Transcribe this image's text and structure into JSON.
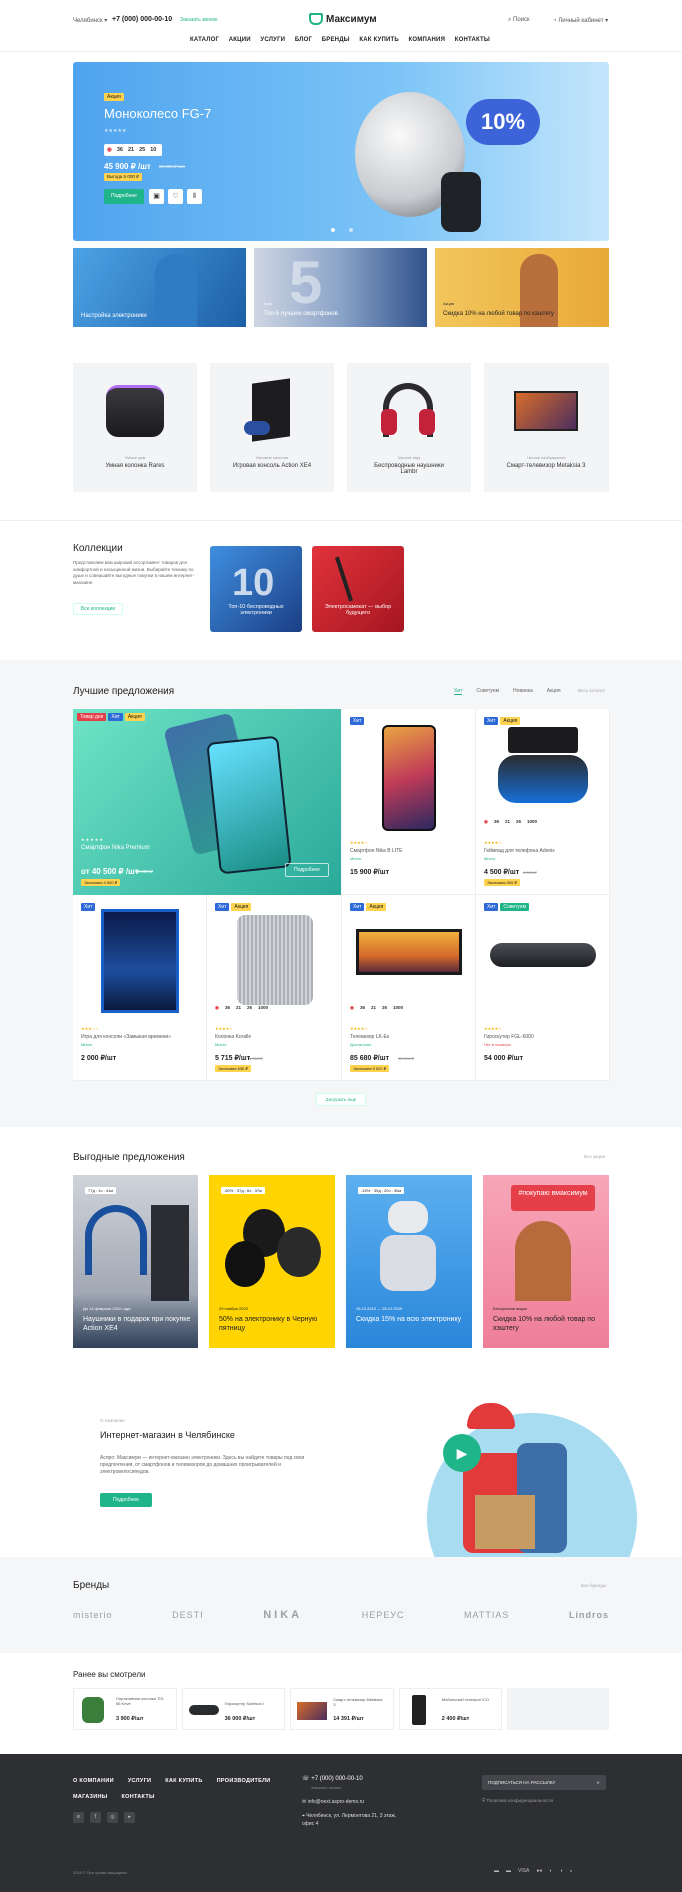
{
  "header": {
    "city": "Челябинск",
    "phone": "+7 (000) 000-00-10",
    "callback": "Заказать звонок",
    "logo": "Максимум",
    "search": "Поиск",
    "account": "Личный кабинет"
  },
  "nav": [
    "КАТАЛОГ",
    "АКЦИИ",
    "УСЛУГИ",
    "БЛОГ",
    "БРЕНДЫ",
    "КАК КУПИТЬ",
    "КОМПАНИЯ",
    "КОНТАКТЫ"
  ],
  "hero": {
    "badge": "Акция",
    "title": "Моноколесо FG-7",
    "timer": [
      "36",
      "21",
      "25",
      "10"
    ],
    "price": "45 900 ₽ /шт",
    "old_price": "50 900 ₽ /шт",
    "stock": "Выгода 5 000 ₽",
    "more": "Подробнее",
    "discount": "10%"
  },
  "banners": [
    {
      "cap": "Настройка электроники"
    },
    {
      "cap": "Топ-5 лучших смартфонов",
      "small": "Блог"
    },
    {
      "cap": "Скидка 10% на любой товар по кэштегу",
      "small": "Акция"
    }
  ],
  "products_top": [
    {
      "cat": "Умные дом",
      "name": "Умная колонка Rares"
    },
    {
      "cat": "Игровые консоли",
      "name": "Игровая консоль Action XE4"
    },
    {
      "cat": "Частый звук",
      "name": "Беспроводные наушники Lambr"
    },
    {
      "cat": "Четкое изображение",
      "name": "Смарт-телевизор Metaksia 3"
    }
  ],
  "collections": {
    "title": "Коллекции",
    "text": "Представляем вам широкий ассортимент товаров для комфортной и насыщенной жизни. Выбирайте технику по душе и совершайте выгодные покупки в нашем интернет-магазине.",
    "button": "Все коллекции",
    "items": [
      "Топ-10 беспроводных электроники",
      "Электросамокат — выбор будущего"
    ]
  },
  "best": {
    "title": "Лучшие предложения",
    "tabs": [
      "Хит",
      "Советуем",
      "Новинка",
      "Акция"
    ],
    "all": "Весь каталог",
    "big": {
      "name": "Смартфон Nika Premium",
      "price": "от 40 500 ₽ /шт",
      "old": "45 000 ₽",
      "econ": "Экономия 4 500 ₽",
      "more": "Подробнее",
      "tags": [
        "Товар дня",
        "Хит",
        "Акция"
      ]
    },
    "items": [
      {
        "name": "Смартфон Nika B LITE",
        "stock": "Много",
        "price": "15 900 ₽/шт",
        "tags": [
          "Хит"
        ]
      },
      {
        "name": "Геймпад для телефона Adonis",
        "stock": "Много",
        "price": "4 500 ₽/шт",
        "old": "5 000 ₽",
        "econ": "Экономия 500 ₽",
        "tags": [
          "Хит",
          "Акция"
        ],
        "timer": [
          "36",
          "21",
          "26",
          "1000"
        ]
      },
      {
        "name": "Игра для консоли «Замыкая времени»",
        "stock": "Много",
        "price": "2 000 ₽/шт",
        "tags": [
          "Хит"
        ]
      },
      {
        "name": "Колонка Koralle",
        "stock": "Много",
        "price": "5 715 ₽/шт",
        "old": "6 350 ₽",
        "econ": "Экономия 635 ₽",
        "tags": [
          "Хит",
          "Акция"
        ],
        "timer": [
          "36",
          "21",
          "26",
          "1000"
        ]
      },
      {
        "name": "Телевизор LK-Ек",
        "stock": "Достаточно",
        "price": "85 680 ₽/шт",
        "old": "95 200 ₽",
        "econ": "Экономия 9 520 ₽",
        "tags": [
          "Хит",
          "Акция"
        ],
        "timer": [
          "36",
          "21",
          "26",
          "1000"
        ]
      },
      {
        "name": "Гироскутер FGL-6000",
        "stock": "Нет в наличии",
        "price": "54 000 ₽/шт",
        "tags": [
          "Хит",
          "Советуем"
        ]
      }
    ],
    "load": "Загрузить еще"
  },
  "sales": {
    "title": "Выгодные предложения",
    "all": "Все акции",
    "items": [
      {
        "date": "До 14 февраля 2020 года",
        "text": "Наушники в подарок при покупке Action XE4",
        "badge": "77д : 1ч : 41м"
      },
      {
        "date": "29 ноября 2020",
        "text": "50% на электронику в Черную пятницу",
        "badge": "-50% · 37д : 6ч : 37м"
      },
      {
        "date": "15.10.2019 — 25.12.2019",
        "text": "Скидка 15% на всю электронику",
        "badge": "-15% · 39д : 20ч : 30м"
      },
      {
        "date": "Бессрочная акция",
        "text": "Скидка 10% на любой товар по хэштегу",
        "badge": "#покупаю вмаксимум"
      }
    ]
  },
  "about": {
    "small": "О компании",
    "title": "Интернет-магазин в Челябинске",
    "text": "Аспро: Максимум — интернет-магазин электроники. Здесь вы найдете товары под свои предпочтения, от смартфонов и телевизоров до домашних проигрывателей и электровелосипедов.",
    "button": "Подробнее"
  },
  "brands": {
    "title": "Бренды",
    "all": "Все бренды",
    "items": [
      "misterio",
      "DESTI",
      "NIKA",
      "НЕРЕУС",
      "MATTIAS",
      "Lindros"
    ]
  },
  "viewed": {
    "title": "Ранее вы смотрели",
    "items": [
      {
        "name": "Портативная колонка TIS-56 Keve",
        "price": "3 900 ₽/шт"
      },
      {
        "name": "Гироскутер Sotelson I",
        "price": "36 000 ₽/шт"
      },
      {
        "name": "Смарт-телевизор Metaksia 3",
        "price": "14 391 ₽/шт"
      },
      {
        "name": "Мобильный телефон ICO",
        "price": "2 400 ₽/шт"
      }
    ]
  },
  "footer": {
    "cols": [
      "О КОМПАНИИ",
      "УСЛУГИ",
      "КАК КУПИТЬ",
      "ПРОИЗВОДИТЕЛИ",
      "МАГАЗИНЫ",
      "КОНТАКТЫ"
    ],
    "phone": "+7 (000) 000-00-10",
    "callback": "Заказать звонок",
    "email": "info@next.aspro-demo.ru",
    "address": "Челябинск, ул. Лермонтова 21, 3 этаж, офис 4",
    "subscribe": "ПОДПИСАТЬСЯ НА РАССЫЛКУ",
    "policy": "Политика конфиденциальности",
    "copy": "2019 © Все права защищены"
  }
}
